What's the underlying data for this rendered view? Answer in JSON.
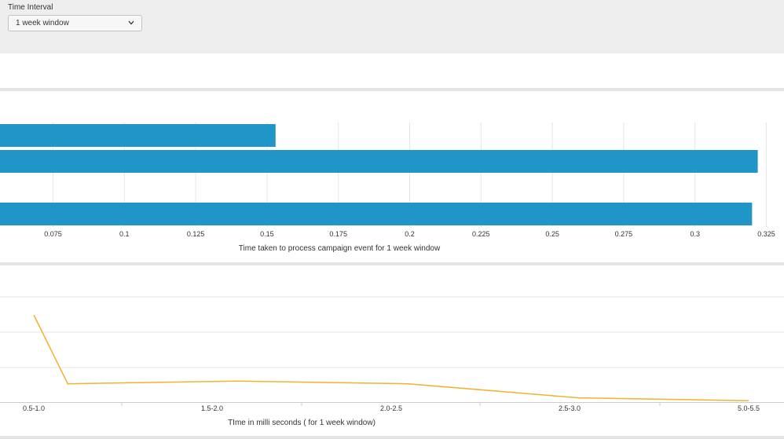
{
  "inputs": {
    "time_interval_label": "Time Interval",
    "time_interval_value": "1 week window"
  },
  "colors": {
    "bar": "#1f95c8",
    "line": "#f2b12e",
    "grid": "#e6e6e6",
    "panel_bg": "#eeeeee"
  },
  "chart_data": [
    {
      "type": "bar",
      "orientation": "horizontal",
      "xlabel": "Time taken to process campaign event for 1 week window",
      "ylabel": "",
      "xticks": [
        0.075,
        0.1,
        0.125,
        0.15,
        0.175,
        0.2,
        0.225,
        0.25,
        0.275,
        0.3,
        0.325
      ],
      "xtick_labels": [
        "0.075",
        "0.1",
        "0.125",
        "0.15",
        "0.175",
        "0.2",
        "0.225",
        "0.25",
        "0.275",
        "0.3",
        "0.325"
      ],
      "series": [
        {
          "values": [
            0.153,
            0.322,
            null,
            0.32
          ]
        }
      ],
      "grid": true
    },
    {
      "type": "line",
      "xlabel": "TIme in milli seconds ( for 1 week window)",
      "ylabel": "",
      "x_labels": [
        "0.5-1.0",
        "1.5-2.0",
        "2.0-2.5",
        "2.5-3.0",
        "5.0-5.5"
      ],
      "series": [
        {
          "points": [
            {
              "x": 0.0,
              "y": 0.62
            },
            {
              "x": 1.0,
              "y": 0.13
            },
            {
              "x": 6.0,
              "y": 0.15
            },
            {
              "x": 11.0,
              "y": 0.13
            },
            {
              "x": 16.0,
              "y": 0.03
            },
            {
              "x": 21.0,
              "y": 0.01
            }
          ]
        }
      ],
      "grid": true
    }
  ]
}
